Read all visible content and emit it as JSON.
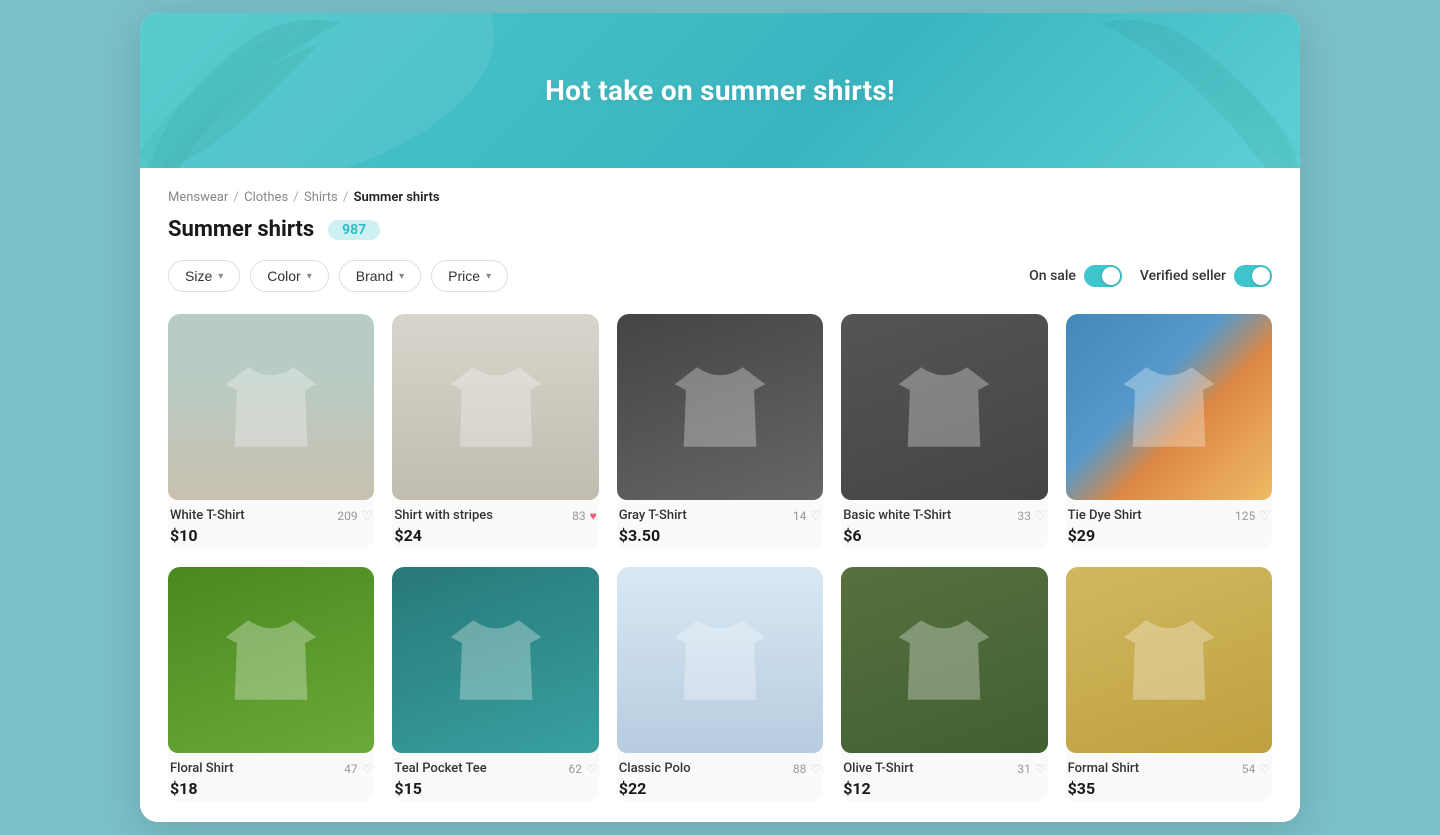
{
  "hero": {
    "title": "Hot take on summer shirts!"
  },
  "breadcrumb": {
    "items": [
      "Menswear",
      "Clothes",
      "Shirts"
    ],
    "current": "Summer shirts"
  },
  "page": {
    "title": "Summer shirts",
    "count": "987"
  },
  "filters": {
    "size_label": "Size",
    "color_label": "Color",
    "brand_label": "Brand",
    "price_label": "Price"
  },
  "toggles": {
    "on_sale_label": "On sale",
    "on_sale_active": true,
    "verified_seller_label": "Verified seller",
    "verified_seller_active": true
  },
  "products": [
    {
      "id": 1,
      "name": "White T-Shirt",
      "price": "$10",
      "likes": 209,
      "liked": false,
      "img_class": "pimg-1"
    },
    {
      "id": 2,
      "name": "Shirt with stripes",
      "price": "$24",
      "likes": 83,
      "liked": true,
      "img_class": "pimg-2"
    },
    {
      "id": 3,
      "name": "Gray T-Shirt",
      "price": "$3.50",
      "likes": 14,
      "liked": false,
      "img_class": "pimg-3"
    },
    {
      "id": 4,
      "name": "Basic white T-Shirt",
      "price": "$6",
      "likes": 33,
      "liked": false,
      "img_class": "pimg-4"
    },
    {
      "id": 5,
      "name": "Tie Dye Shirt",
      "price": "$29",
      "likes": 125,
      "liked": false,
      "img_class": "pimg-5"
    },
    {
      "id": 6,
      "name": "Floral Shirt",
      "price": "$18",
      "likes": 47,
      "liked": false,
      "img_class": "pimg-6"
    },
    {
      "id": 7,
      "name": "Teal Pocket Tee",
      "price": "$15",
      "likes": 62,
      "liked": false,
      "img_class": "pimg-7"
    },
    {
      "id": 8,
      "name": "Classic Polo",
      "price": "$22",
      "likes": 88,
      "liked": false,
      "img_class": "pimg-8"
    },
    {
      "id": 9,
      "name": "Olive T-Shirt",
      "price": "$12",
      "likes": 31,
      "liked": false,
      "img_class": "pimg-9"
    },
    {
      "id": 10,
      "name": "Formal Shirt",
      "price": "$35",
      "likes": 54,
      "liked": false,
      "img_class": "pimg-10"
    }
  ]
}
